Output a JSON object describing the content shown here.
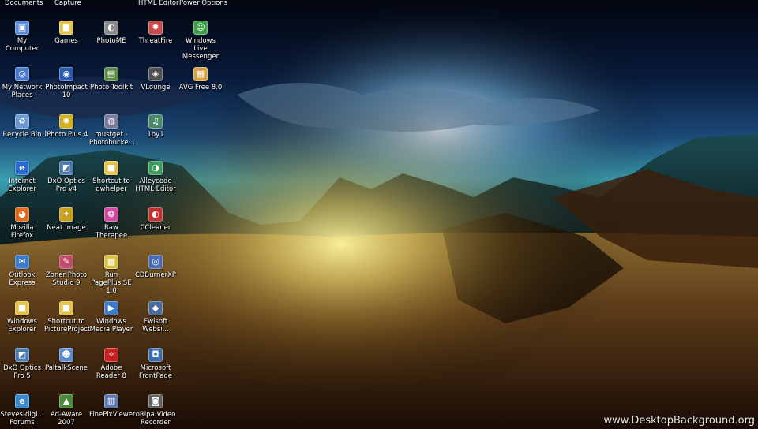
{
  "top_row": [
    "Documents",
    "Capture",
    "HTML Editor",
    "Power Options"
  ],
  "icons": [
    {
      "label": "My Computer",
      "icon": "computer-icon",
      "color": "#5a8ad8",
      "glyph": "▣"
    },
    {
      "label": "Games",
      "icon": "folder-icon",
      "color": "#e6c24a",
      "glyph": "■"
    },
    {
      "label": "PhotoME",
      "icon": "photome-icon",
      "color": "#8a8a8a",
      "glyph": "◐"
    },
    {
      "label": "ThreatFire",
      "icon": "threatfire-icon",
      "color": "#c84a4a",
      "glyph": "✹"
    },
    {
      "label": "Windows Live Messenger",
      "icon": "messenger-icon",
      "color": "#3fa04a",
      "glyph": "☺"
    },
    {
      "label": "My Network Places",
      "icon": "network-icon",
      "color": "#4a7ac8",
      "glyph": "◎"
    },
    {
      "label": "PhotoImpact 10",
      "icon": "photoimpact-icon",
      "color": "#2a5ab0",
      "glyph": "◉"
    },
    {
      "label": "Photo Toolkit",
      "icon": "photo-toolkit-icon",
      "color": "#5a8a4a",
      "glyph": "▤"
    },
    {
      "label": "VLounge",
      "icon": "vlounge-icon",
      "color": "#505050",
      "glyph": "◈"
    },
    {
      "label": "AVG Free 8.0",
      "icon": "avg-icon",
      "color": "#d8a040",
      "glyph": "▦"
    },
    {
      "label": "Recycle Bin",
      "icon": "recycle-bin-icon",
      "color": "#6a9ad0",
      "glyph": "♻"
    },
    {
      "label": "iPhoto Plus 4",
      "icon": "iphoto-icon",
      "color": "#d0b020",
      "glyph": "✺"
    },
    {
      "label": "mustget - Photobucke...",
      "icon": "mustget-icon",
      "color": "#7a7a9a",
      "glyph": "◍"
    },
    {
      "label": "1by1",
      "icon": "1by1-icon",
      "color": "#4a8a6a",
      "glyph": "♫"
    },
    {
      "label": "Internet Explorer",
      "icon": "internet-explorer-icon",
      "color": "#2a6ad0",
      "glyph": "e"
    },
    {
      "label": "DxO Optics Pro v4",
      "icon": "dxo-icon",
      "color": "#4a7ab0",
      "glyph": "◩"
    },
    {
      "label": "Shortcut to dwhelper",
      "icon": "folder-icon",
      "color": "#e6c24a",
      "glyph": "■"
    },
    {
      "label": "Alleycode HTML Editor",
      "icon": "alleycode-icon",
      "color": "#3a9a5a",
      "glyph": "◑"
    },
    {
      "label": "Mozilla Firefox",
      "icon": "firefox-icon",
      "color": "#e06a20",
      "glyph": "◕"
    },
    {
      "label": "Neat Image",
      "icon": "neat-image-icon",
      "color": "#c8a020",
      "glyph": "✦"
    },
    {
      "label": "Raw Therapee",
      "icon": "raw-therapee-icon",
      "color": "#d04aa0",
      "glyph": "❂"
    },
    {
      "label": "CCleaner",
      "icon": "ccleaner-icon",
      "color": "#c03030",
      "glyph": "◐"
    },
    {
      "label": "Outlook Express",
      "icon": "outlook-icon",
      "color": "#3a7ac8",
      "glyph": "✉"
    },
    {
      "label": "Zoner Photo Studio 9",
      "icon": "zoner-icon",
      "color": "#c04a6a",
      "glyph": "✎"
    },
    {
      "label": "Run PagePlus SE 1.0",
      "icon": "pageplus-icon",
      "color": "#d8c040",
      "glyph": "▩"
    },
    {
      "label": "CDBurnerXP",
      "icon": "cdburner-icon",
      "color": "#4a6ab0",
      "glyph": "◎"
    },
    {
      "label": "Windows Explorer",
      "icon": "folder-icon",
      "color": "#e6c24a",
      "glyph": "■"
    },
    {
      "label": "Shortcut to PictureProject",
      "icon": "folder-icon",
      "color": "#e6c24a",
      "glyph": "■"
    },
    {
      "label": "Windows Media Player",
      "icon": "media-player-icon",
      "color": "#3a7ac8",
      "glyph": "▶"
    },
    {
      "label": "Ewisoft Websi...",
      "icon": "ewisoft-icon",
      "color": "#4a6aa0",
      "glyph": "◆"
    },
    {
      "label": "DxO Optics Pro 5",
      "icon": "dxo-icon",
      "color": "#4a7ab0",
      "glyph": "◩"
    },
    {
      "label": "PaltalkScene",
      "icon": "paltalk-icon",
      "color": "#5a8ad0",
      "glyph": "☻"
    },
    {
      "label": "Adobe Reader 8",
      "icon": "adobe-reader-icon",
      "color": "#c82020",
      "glyph": "✧"
    },
    {
      "label": "Microsoft FrontPage",
      "icon": "frontpage-icon",
      "color": "#3a6ab0",
      "glyph": "◘"
    },
    {
      "label": "Steves-digi... Forums",
      "icon": "web-shortcut-icon",
      "color": "#3a8ad0",
      "glyph": "e"
    },
    {
      "label": "Ad-Aware 2007",
      "icon": "ad-aware-icon",
      "color": "#4a8a3a",
      "glyph": "▲"
    },
    {
      "label": "FinePixViewer",
      "icon": "finepix-icon",
      "color": "#5a7ab0",
      "glyph": "▥"
    },
    {
      "label": "oRipa Video Recorder",
      "icon": "oripa-icon",
      "color": "#606060",
      "glyph": "◙"
    }
  ],
  "watermark": "www.DesktopBackground.org"
}
